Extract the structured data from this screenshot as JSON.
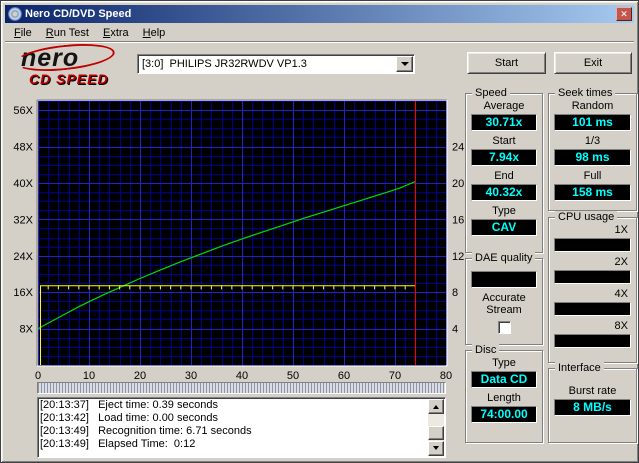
{
  "window": {
    "title": "Nero CD/DVD Speed"
  },
  "menu": {
    "items": [
      "File",
      "Run Test",
      "Extra",
      "Help"
    ]
  },
  "toolbar": {
    "logo_line1": "nero",
    "logo_line2": "CD SPEED",
    "drive_selected": "[3:0]  PHILIPS JR32RWDV VP1.3",
    "start_label": "Start",
    "exit_label": "Exit"
  },
  "colors": {
    "window_bg": "#d4d0c8",
    "titlebar_left": "#0a246a",
    "titlebar_right": "#a6caf0",
    "value_text": "#00ffff",
    "value_bg": "#000000",
    "curve_speed": "#00dd00",
    "curve_rotation": "#ffff00",
    "cursor": "#ff0000"
  },
  "chart_data": {
    "type": "line",
    "title": "",
    "x": {
      "min": 0,
      "max": 80,
      "ticks": [
        0,
        10,
        20,
        30,
        40,
        50,
        60,
        70,
        80
      ],
      "minor_step": 2,
      "label": ""
    },
    "y_left": {
      "min": 0,
      "max": 58,
      "ticks": [
        8,
        16,
        24,
        32,
        40,
        48,
        56
      ],
      "tick_suffix": "X",
      "minor_step": 2
    },
    "y_right": {
      "ticks": [
        {
          "value": "4",
          "at": 8
        },
        {
          "value": "8",
          "at": 16
        },
        {
          "value": "12",
          "at": 24
        },
        {
          "value": "16",
          "at": 32
        },
        {
          "value": "20",
          "at": 40
        },
        {
          "value": "24",
          "at": 48
        }
      ]
    },
    "bg": "#000000",
    "grid_color": "#000090",
    "grid_major_color": "#2222c8",
    "series": [
      {
        "name": "read-speed",
        "color": "#00dd00",
        "points_x": [
          0,
          1,
          2,
          3,
          5,
          8,
          10,
          13,
          16,
          20,
          24,
          28,
          32,
          36,
          40,
          44,
          48,
          52,
          56,
          60,
          64,
          68,
          71,
          74
        ],
        "points_y": [
          7.94,
          8.6,
          9.2,
          9.8,
          11.0,
          12.8,
          13.9,
          15.5,
          17.0,
          19.0,
          20.9,
          22.7,
          24.4,
          26.1,
          27.7,
          29.2,
          30.7,
          32.2,
          33.6,
          35.0,
          36.4,
          37.8,
          38.9,
          40.32
        ]
      },
      {
        "name": "rotation-speed",
        "color": "#ffff00",
        "flat": {
          "base": 17.4,
          "x_start": 0.5,
          "x_end": 74,
          "tick_every": 2,
          "tick_depth": 0.8
        }
      }
    ],
    "cursor": {
      "x": 74,
      "color": "#ff0000"
    }
  },
  "panels": {
    "speed": {
      "title": "Speed",
      "fields": [
        {
          "label": "Average",
          "value": "30.71x"
        },
        {
          "label": "Start",
          "value": "7.94x"
        },
        {
          "label": "End",
          "value": "40.32x"
        },
        {
          "label": "Type",
          "value": "CAV"
        }
      ]
    },
    "seek_times": {
      "title": "Seek times",
      "fields": [
        {
          "label": "Random",
          "value": "101 ms"
        },
        {
          "label": "1/3",
          "value": "98 ms"
        },
        {
          "label": "Full",
          "value": "158 ms"
        }
      ]
    },
    "cpu_usage": {
      "title": "CPU usage",
      "fields": [
        {
          "label": "1X",
          "value": ""
        },
        {
          "label": "2X",
          "value": ""
        },
        {
          "label": "4X",
          "value": ""
        },
        {
          "label": "8X",
          "value": ""
        }
      ]
    },
    "dae_quality": {
      "title": "DAE quality",
      "value": "",
      "accurate_stream_label": "Accurate Stream",
      "accurate_stream_checked": false
    },
    "disc": {
      "title": "Disc",
      "fields": [
        {
          "label": "Type",
          "value": "Data CD"
        },
        {
          "label": "Length",
          "value": "74:00.00"
        }
      ]
    },
    "interface": {
      "title": "Interface",
      "fields": [
        {
          "label": "Burst rate",
          "value": "8 MB/s"
        }
      ]
    }
  },
  "log": {
    "lines": [
      "[20:13:37]   Eject time: 0.39 seconds",
      "[20:13:42]   Load time: 0.00 seconds",
      "[20:13:49]   Recognition time: 6.71 seconds",
      "[20:13:49]   Elapsed Time:  0:12"
    ]
  }
}
